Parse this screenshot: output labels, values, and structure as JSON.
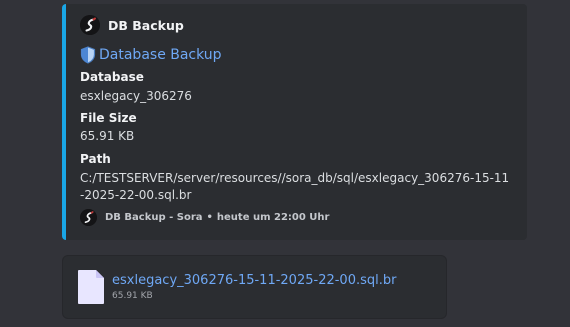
{
  "embed": {
    "accent_color": "#1aa6e6",
    "author": {
      "name": "DB Backup",
      "avatar_icon": "db-backup-logo-icon"
    },
    "title": {
      "icon": "shield-icon",
      "text": "Database Backup"
    },
    "fields": [
      {
        "name": "Database",
        "value": "esxlegacy_306276"
      },
      {
        "name": "File Size",
        "value": "65.91 KB"
      },
      {
        "name": "Path",
        "value": "C:/TESTSERVER/server/resources//sora_db/sql/esxlegacy_306276-15-11-2025-22-00.sql.br"
      }
    ],
    "footer": {
      "source": "DB Backup - Sora",
      "separator": "•",
      "timestamp": "heute um 22:00 Uhr"
    }
  },
  "attachment": {
    "icon": "file-icon",
    "filename": "esxlegacy_306276-15-11-2025-22-00.sql.br",
    "size": "65.91 KB"
  }
}
